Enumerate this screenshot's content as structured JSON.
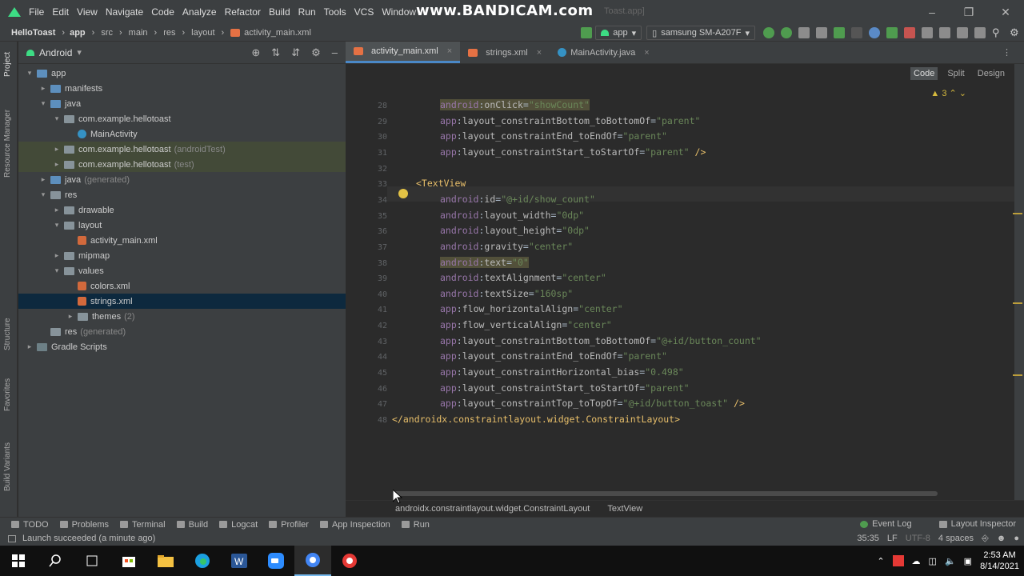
{
  "watermark": "www.BANDICAM.com",
  "menu": [
    "File",
    "Edit",
    "View",
    "Navigate",
    "Code",
    "Analyze",
    "Refactor",
    "Build",
    "Run",
    "Tools",
    "VCS",
    "Window"
  ],
  "title_tail": "Toast.app]",
  "breadcrumbs": [
    "HelloToast",
    "app",
    "src",
    "main",
    "res",
    "layout",
    "activity_main.xml"
  ],
  "toolbar": {
    "run_config": "app",
    "device": "samsung SM-A207F"
  },
  "project_panel": {
    "view": "Android"
  },
  "tree": [
    {
      "label": "app",
      "depth": 0,
      "arrow": "▾",
      "icon": "folder-blue",
      "note": ""
    },
    {
      "label": "manifests",
      "depth": 1,
      "arrow": "▸",
      "icon": "folder-blue",
      "note": ""
    },
    {
      "label": "java",
      "depth": 1,
      "arrow": "▾",
      "icon": "folder-blue",
      "note": ""
    },
    {
      "label": "com.example.hellotoast",
      "depth": 2,
      "arrow": "▾",
      "icon": "folder",
      "note": ""
    },
    {
      "label": "MainActivity",
      "depth": 3,
      "arrow": "",
      "icon": "class",
      "note": ""
    },
    {
      "label": "com.example.hellotoast",
      "depth": 2,
      "arrow": "▸",
      "icon": "folder",
      "note": "(androidTest)"
    },
    {
      "label": "com.example.hellotoast",
      "depth": 2,
      "arrow": "▸",
      "icon": "folder",
      "note": "(test)"
    },
    {
      "label": "java",
      "depth": 1,
      "arrow": "▸",
      "icon": "folder-blue",
      "note": "(generated)"
    },
    {
      "label": "res",
      "depth": 1,
      "arrow": "▾",
      "icon": "folder",
      "note": ""
    },
    {
      "label": "drawable",
      "depth": 2,
      "arrow": "▸",
      "icon": "folder",
      "note": ""
    },
    {
      "label": "layout",
      "depth": 2,
      "arrow": "▾",
      "icon": "folder",
      "note": ""
    },
    {
      "label": "activity_main.xml",
      "depth": 3,
      "arrow": "",
      "icon": "xml",
      "note": ""
    },
    {
      "label": "mipmap",
      "depth": 2,
      "arrow": "▸",
      "icon": "folder",
      "note": ""
    },
    {
      "label": "values",
      "depth": 2,
      "arrow": "▾",
      "icon": "folder",
      "note": ""
    },
    {
      "label": "colors.xml",
      "depth": 3,
      "arrow": "",
      "icon": "xml",
      "note": ""
    },
    {
      "label": "strings.xml",
      "depth": 3,
      "arrow": "",
      "icon": "xml",
      "note": ""
    },
    {
      "label": "themes",
      "depth": 3,
      "arrow": "▸",
      "icon": "folder",
      "note": "(2)"
    },
    {
      "label": "res",
      "depth": 1,
      "arrow": "",
      "icon": "folder",
      "note": "(generated)"
    },
    {
      "label": "Gradle Scripts",
      "depth": 0,
      "arrow": "▸",
      "icon": "gradle",
      "note": ""
    }
  ],
  "tabs": [
    "activity_main.xml",
    "strings.xml",
    "MainActivity.java"
  ],
  "modes": [
    "Code",
    "Split",
    "Design"
  ],
  "warnings": "3",
  "code_lines": [
    {
      "n": "28",
      "text": "android:onClick=\"showCount\""
    },
    {
      "n": "29",
      "text": "app:layout_constraintBottom_toBottomOf=\"parent\""
    },
    {
      "n": "30",
      "text": "app:layout_constraintEnd_toEndOf=\"parent\""
    },
    {
      "n": "31",
      "text": "app:layout_constraintStart_toStartOf=\"parent\" />"
    },
    {
      "n": "32",
      "text": ""
    },
    {
      "n": "33",
      "text": "<TextView"
    },
    {
      "n": "34",
      "text": "android:id=\"@+id/show_count\""
    },
    {
      "n": "35",
      "text": "android:layout_width=\"0dp\""
    },
    {
      "n": "36",
      "text": "android:layout_height=\"0dp\""
    },
    {
      "n": "37",
      "text": "android:gravity=\"center\""
    },
    {
      "n": "38",
      "text": "android:text=\"0\""
    },
    {
      "n": "39",
      "text": "android:textAlignment=\"center\""
    },
    {
      "n": "40",
      "text": "android:textSize=\"160sp\""
    },
    {
      "n": "41",
      "text": "app:flow_horizontalAlign=\"center\""
    },
    {
      "n": "42",
      "text": "app:flow_verticalAlign=\"center\""
    },
    {
      "n": "43",
      "text": "app:layout_constraintBottom_toBottomOf=\"@+id/button_count\""
    },
    {
      "n": "44",
      "text": "app:layout_constraintEnd_toEndOf=\"parent\""
    },
    {
      "n": "45",
      "text": "app:layout_constraintHorizontal_bias=\"0.498\""
    },
    {
      "n": "46",
      "text": "app:layout_constraintStart_toStartOf=\"parent\""
    },
    {
      "n": "47",
      "text": "app:layout_constraintTop_toTopOf=\"@+id/button_toast\" />"
    },
    {
      "n": "48",
      "text": "</androidx.constraintlayout.widget.ConstraintLayout>"
    }
  ],
  "code_breadcrumb": [
    "androidx.constraintlayout.widget.ConstraintLayout",
    "TextView"
  ],
  "tool_windows": [
    "TODO",
    "Problems",
    "Terminal",
    "Build",
    "Logcat",
    "Profiler",
    "App Inspection",
    "Run"
  ],
  "tool_windows_right": [
    "Event Log",
    "Layout Inspector"
  ],
  "side_tools_left": [
    "Project",
    "Resource Manager",
    "Structure",
    "Favorites",
    "Build Variants"
  ],
  "status": {
    "message": "Launch succeeded (a minute ago)",
    "position": "35:35",
    "line_sep": "LF",
    "encoding": "UTF-8",
    "indent": "4 spaces"
  },
  "clock": {
    "time": "2:53 AM",
    "date": "8/14/2021"
  },
  "colors": {
    "accent": "#4a88c7",
    "android": "#3ddc84",
    "selection": "#0d293e"
  }
}
